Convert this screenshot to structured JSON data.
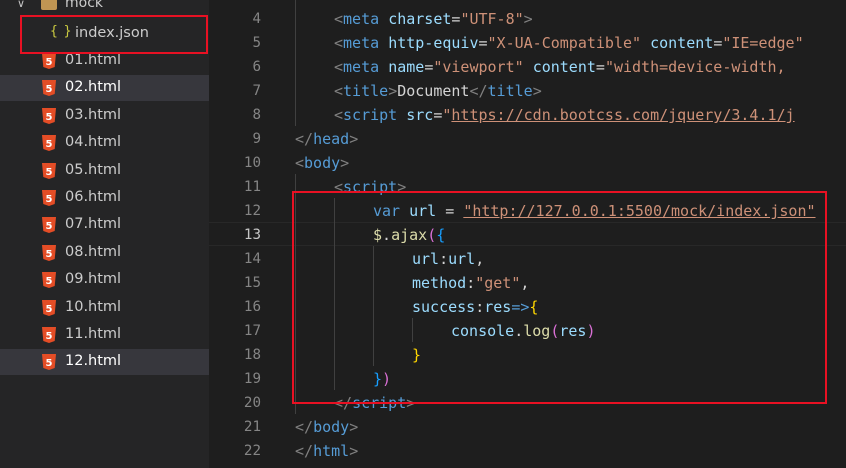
{
  "explorer": {
    "folder": "mock",
    "json_file": "index.json",
    "files": [
      "01.html",
      "02.html",
      "03.html",
      "04.html",
      "05.html",
      "06.html",
      "07.html",
      "08.html",
      "09.html",
      "10.html",
      "11.html",
      "12.html"
    ],
    "selected": [
      "02.html",
      "12.html"
    ]
  },
  "editor": {
    "line_numbers": [
      "4",
      "5",
      "6",
      "7",
      "8",
      "9",
      "10",
      "11",
      "12",
      "13",
      "14",
      "15",
      "16",
      "17",
      "18",
      "19",
      "20",
      "21",
      "22"
    ],
    "current_line": "13",
    "l4": [
      "<",
      "meta",
      " ",
      "charset",
      "=",
      "\"UTF-8\"",
      ">"
    ],
    "l5": [
      "<",
      "meta",
      " ",
      "http-equiv",
      "=",
      "\"X-UA-Compatible\"",
      " ",
      "content",
      "=",
      "\"IE=edge\""
    ],
    "l6": [
      "<",
      "meta",
      " ",
      "name",
      "=",
      "\"viewport\"",
      " ",
      "content",
      "=",
      "\"width=device-width,"
    ],
    "l7": [
      "<",
      "title",
      ">",
      "Document",
      "</",
      "title",
      ">"
    ],
    "l8": [
      "<",
      "script",
      " ",
      "src",
      "=",
      "\"",
      "https://cdn.bootcss.com/jquery/3.4.1/j"
    ],
    "l9": [
      "</",
      "head",
      ">"
    ],
    "l10": [
      "<",
      "body",
      ">"
    ],
    "l11": [
      "<",
      "script",
      ">"
    ],
    "l12": [
      "var",
      " ",
      "url",
      " = ",
      "\"http://127.0.0.1:5500/mock/index.json\""
    ],
    "l13": [
      "$",
      ".",
      "ajax",
      "(",
      "{"
    ],
    "l14": [
      "url",
      ":",
      "url",
      ","
    ],
    "l15": [
      "method",
      ":",
      "\"get\"",
      ","
    ],
    "l16": [
      "success",
      ":",
      "res",
      "=>",
      "{"
    ],
    "l17": [
      "console",
      ".",
      "log",
      "(",
      "res",
      ")"
    ],
    "l18": [
      "}"
    ],
    "l19": [
      "}",
      ")"
    ],
    "l20": [
      "</",
      "script",
      ">"
    ],
    "l21": [
      "</",
      "body",
      ">"
    ],
    "l22": [
      "</",
      "html",
      ">"
    ]
  },
  "colors": {
    "highlight_box": "#e81123",
    "tag": "#569cd6",
    "attribute": "#9cdcfe",
    "string": "#ce9178",
    "function": "#dcdcaa",
    "bracket_purple": "#da70d6",
    "bracket_blue": "#179fff"
  }
}
